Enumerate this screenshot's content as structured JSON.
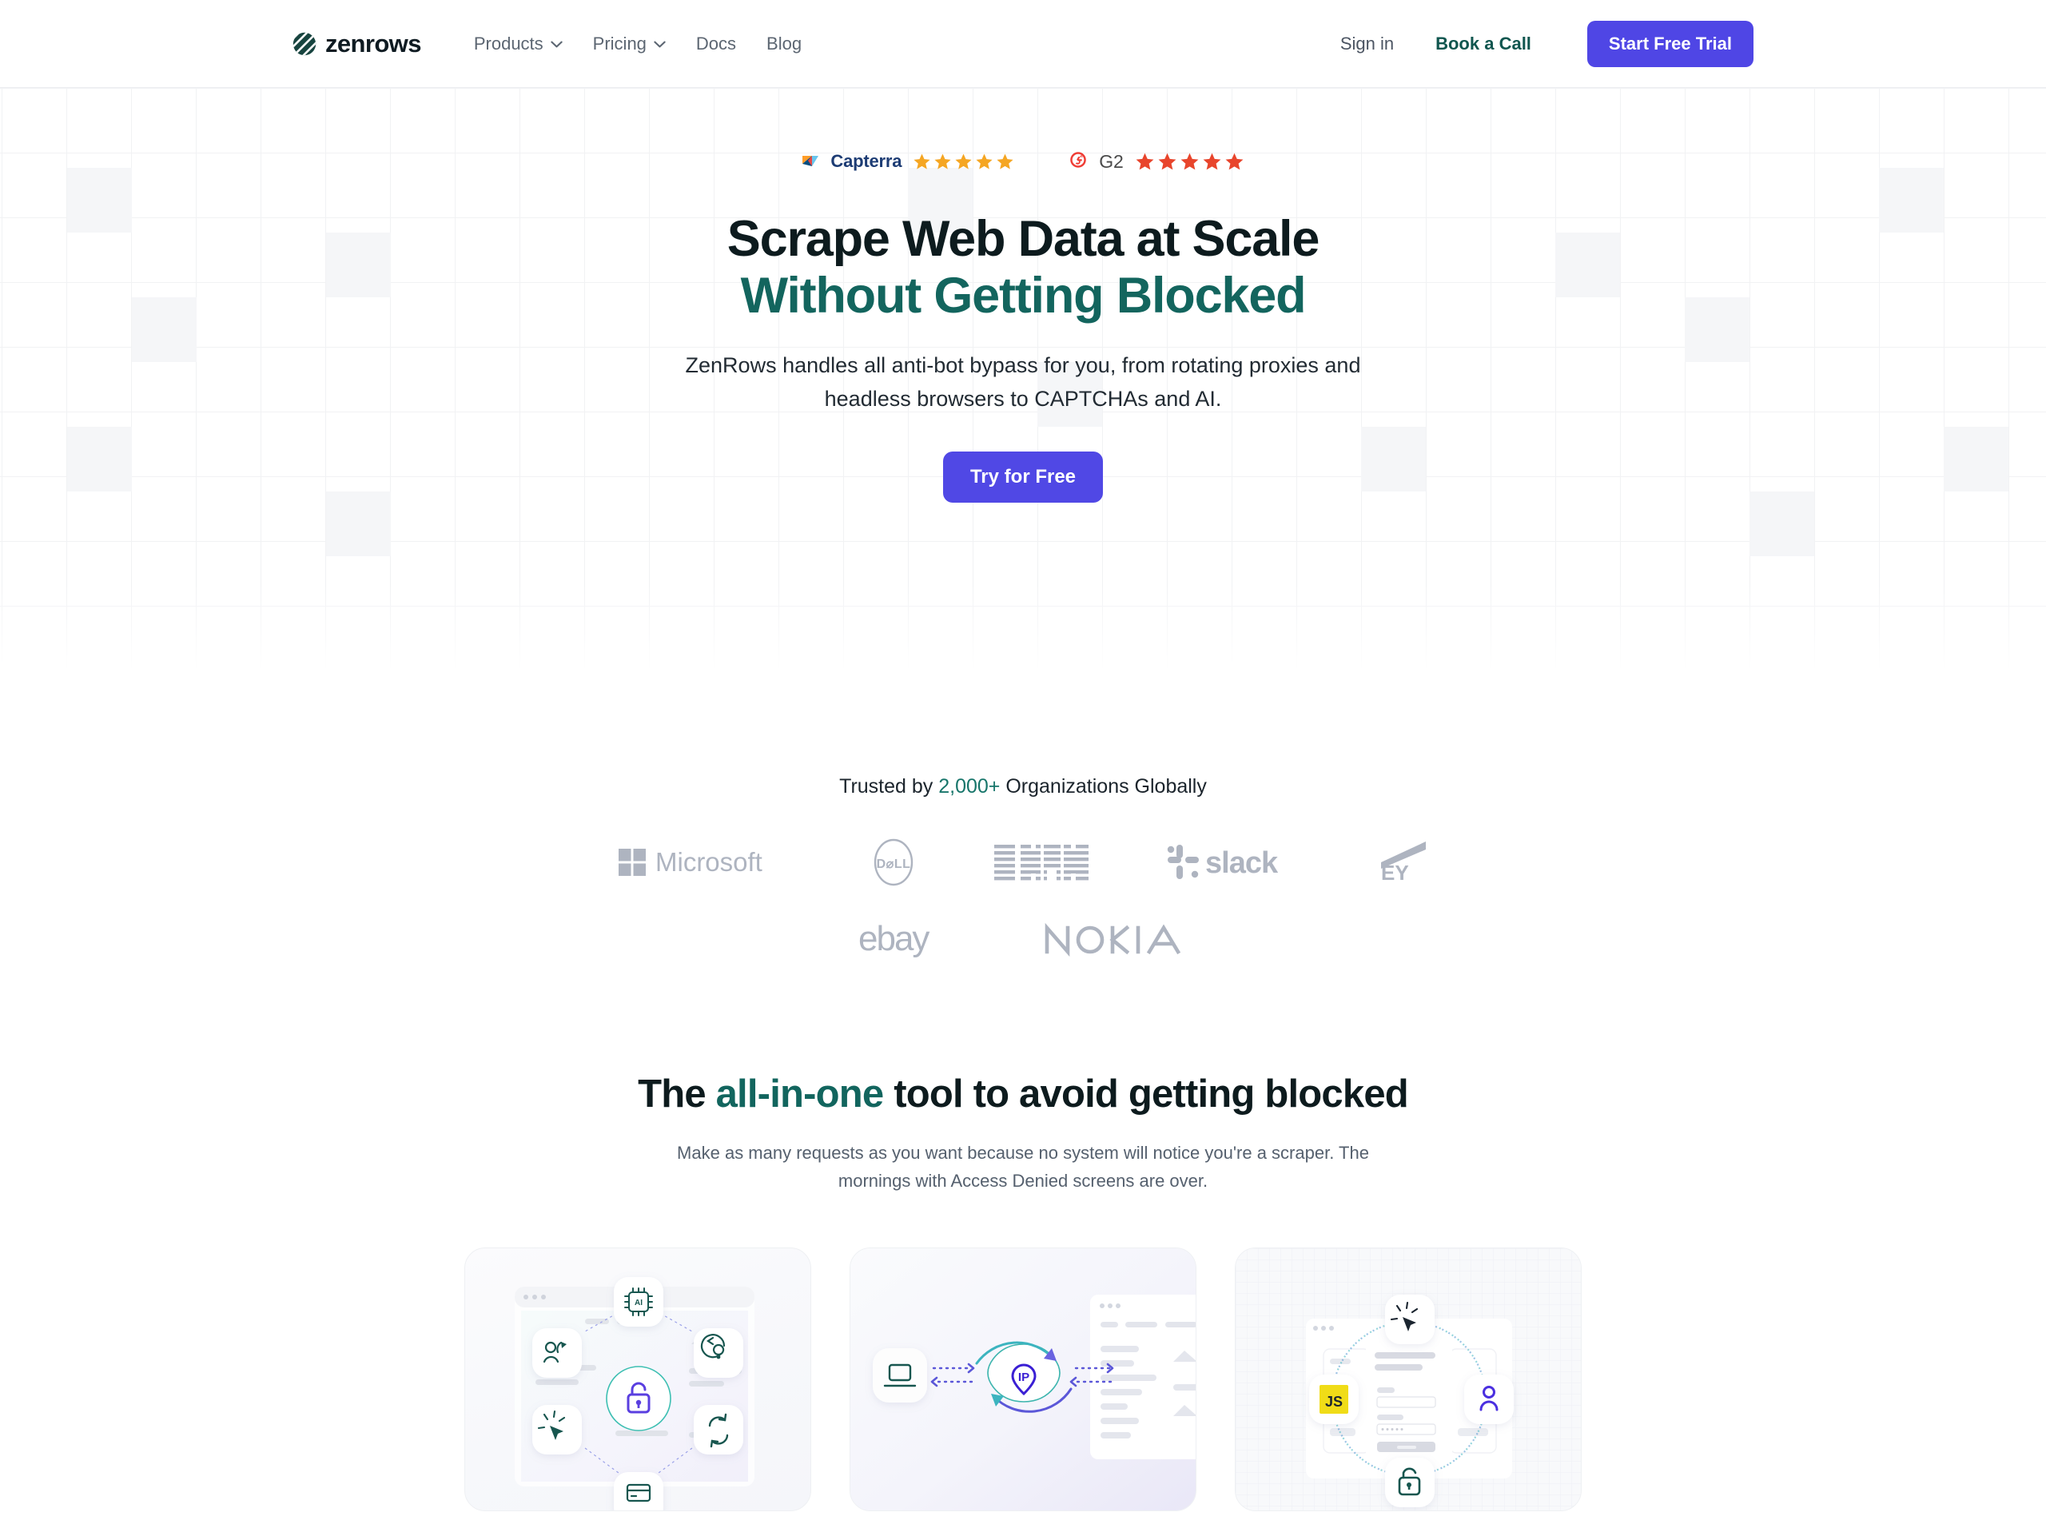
{
  "nav": {
    "logo_text": "zenrows",
    "logo_icon": "zenrows-logo-icon",
    "links": [
      {
        "label": "Products",
        "has_dropdown": true
      },
      {
        "label": "Pricing",
        "has_dropdown": true
      },
      {
        "label": "Docs",
        "has_dropdown": false
      },
      {
        "label": "Blog",
        "has_dropdown": false
      }
    ],
    "signin_label": "Sign in",
    "bookcall_label": "Book a Call",
    "cta_label": "Start Free Trial"
  },
  "hero": {
    "badges": [
      {
        "name": "Capterra",
        "stars": 5,
        "star_color": "#f5a623"
      },
      {
        "name": "G2",
        "stars": 5,
        "star_color": "#e8452c"
      }
    ],
    "title_line1": "Scrape Web Data at Scale",
    "title_line2": "Without Getting Blocked",
    "subtitle": "ZenRows handles all anti-bot bypass for you, from rotating proxies and headless browsers to CAPTCHAs and AI.",
    "cta_label": "Try for Free"
  },
  "trusted": {
    "prefix": "Trusted by ",
    "count": "2,000+",
    "suffix": " Organizations Globally",
    "logos_row1": [
      "Microsoft",
      "DELL",
      "IBM",
      "slack",
      "EY"
    ],
    "logos_row2": [
      "ebay",
      "NOKIA"
    ]
  },
  "section2": {
    "title_pre": "The ",
    "title_hl": "all-in-one",
    "title_post": " tool to avoid getting blocked",
    "subtitle": "Make as many requests as you want because no system will notice you're a scraper. The mornings with Access Denied screens are over.",
    "cards": [
      {
        "id": "anti-bot-bypass-card",
        "center_icon": "unlock-icon",
        "orbit_icons": [
          "ai-chip-icon",
          "user-rotate-icon",
          "location-refresh-icon",
          "cursor-click-icon",
          "refresh-icon",
          "card-icon"
        ]
      },
      {
        "id": "ip-rotation-card",
        "center_icon": "ip-pin-icon",
        "orbit_icons": [
          "laptop-icon",
          "webpage-icon",
          "rotate-arrows-icon"
        ]
      },
      {
        "id": "js-rendering-card",
        "center_icon": "login-form-icon",
        "orbit_icons": [
          "cursor-click-icon",
          "js-badge-icon",
          "user-icon",
          "unlock-icon"
        ]
      }
    ]
  },
  "colors": {
    "brand_teal": "#13655e",
    "accent_indigo": "#5048e5",
    "nav_cta": "#4f46e5",
    "muted_gray": "#aeb4c0",
    "capterra_star": "#f5a623",
    "g2_star": "#e8452c"
  }
}
